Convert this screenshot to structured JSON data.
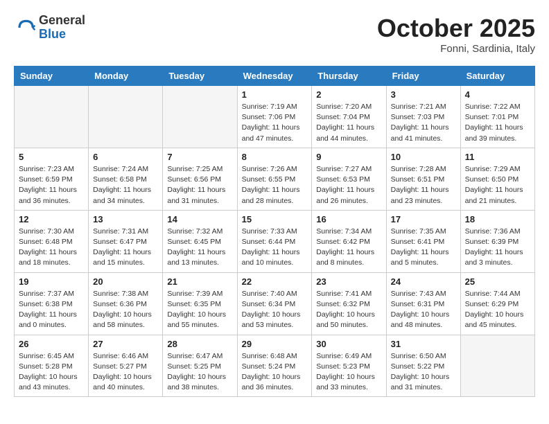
{
  "header": {
    "logo_general": "General",
    "logo_blue": "Blue",
    "month_title": "October 2025",
    "location": "Fonni, Sardinia, Italy"
  },
  "days_of_week": [
    "Sunday",
    "Monday",
    "Tuesday",
    "Wednesday",
    "Thursday",
    "Friday",
    "Saturday"
  ],
  "weeks": [
    [
      {
        "day": "",
        "info": ""
      },
      {
        "day": "",
        "info": ""
      },
      {
        "day": "",
        "info": ""
      },
      {
        "day": "1",
        "info": "Sunrise: 7:19 AM\nSunset: 7:06 PM\nDaylight: 11 hours\nand 47 minutes."
      },
      {
        "day": "2",
        "info": "Sunrise: 7:20 AM\nSunset: 7:04 PM\nDaylight: 11 hours\nand 44 minutes."
      },
      {
        "day": "3",
        "info": "Sunrise: 7:21 AM\nSunset: 7:03 PM\nDaylight: 11 hours\nand 41 minutes."
      },
      {
        "day": "4",
        "info": "Sunrise: 7:22 AM\nSunset: 7:01 PM\nDaylight: 11 hours\nand 39 minutes."
      }
    ],
    [
      {
        "day": "5",
        "info": "Sunrise: 7:23 AM\nSunset: 6:59 PM\nDaylight: 11 hours\nand 36 minutes."
      },
      {
        "day": "6",
        "info": "Sunrise: 7:24 AM\nSunset: 6:58 PM\nDaylight: 11 hours\nand 34 minutes."
      },
      {
        "day": "7",
        "info": "Sunrise: 7:25 AM\nSunset: 6:56 PM\nDaylight: 11 hours\nand 31 minutes."
      },
      {
        "day": "8",
        "info": "Sunrise: 7:26 AM\nSunset: 6:55 PM\nDaylight: 11 hours\nand 28 minutes."
      },
      {
        "day": "9",
        "info": "Sunrise: 7:27 AM\nSunset: 6:53 PM\nDaylight: 11 hours\nand 26 minutes."
      },
      {
        "day": "10",
        "info": "Sunrise: 7:28 AM\nSunset: 6:51 PM\nDaylight: 11 hours\nand 23 minutes."
      },
      {
        "day": "11",
        "info": "Sunrise: 7:29 AM\nSunset: 6:50 PM\nDaylight: 11 hours\nand 21 minutes."
      }
    ],
    [
      {
        "day": "12",
        "info": "Sunrise: 7:30 AM\nSunset: 6:48 PM\nDaylight: 11 hours\nand 18 minutes."
      },
      {
        "day": "13",
        "info": "Sunrise: 7:31 AM\nSunset: 6:47 PM\nDaylight: 11 hours\nand 15 minutes."
      },
      {
        "day": "14",
        "info": "Sunrise: 7:32 AM\nSunset: 6:45 PM\nDaylight: 11 hours\nand 13 minutes."
      },
      {
        "day": "15",
        "info": "Sunrise: 7:33 AM\nSunset: 6:44 PM\nDaylight: 11 hours\nand 10 minutes."
      },
      {
        "day": "16",
        "info": "Sunrise: 7:34 AM\nSunset: 6:42 PM\nDaylight: 11 hours\nand 8 minutes."
      },
      {
        "day": "17",
        "info": "Sunrise: 7:35 AM\nSunset: 6:41 PM\nDaylight: 11 hours\nand 5 minutes."
      },
      {
        "day": "18",
        "info": "Sunrise: 7:36 AM\nSunset: 6:39 PM\nDaylight: 11 hours\nand 3 minutes."
      }
    ],
    [
      {
        "day": "19",
        "info": "Sunrise: 7:37 AM\nSunset: 6:38 PM\nDaylight: 11 hours\nand 0 minutes."
      },
      {
        "day": "20",
        "info": "Sunrise: 7:38 AM\nSunset: 6:36 PM\nDaylight: 10 hours\nand 58 minutes."
      },
      {
        "day": "21",
        "info": "Sunrise: 7:39 AM\nSunset: 6:35 PM\nDaylight: 10 hours\nand 55 minutes."
      },
      {
        "day": "22",
        "info": "Sunrise: 7:40 AM\nSunset: 6:34 PM\nDaylight: 10 hours\nand 53 minutes."
      },
      {
        "day": "23",
        "info": "Sunrise: 7:41 AM\nSunset: 6:32 PM\nDaylight: 10 hours\nand 50 minutes."
      },
      {
        "day": "24",
        "info": "Sunrise: 7:43 AM\nSunset: 6:31 PM\nDaylight: 10 hours\nand 48 minutes."
      },
      {
        "day": "25",
        "info": "Sunrise: 7:44 AM\nSunset: 6:29 PM\nDaylight: 10 hours\nand 45 minutes."
      }
    ],
    [
      {
        "day": "26",
        "info": "Sunrise: 6:45 AM\nSunset: 5:28 PM\nDaylight: 10 hours\nand 43 minutes."
      },
      {
        "day": "27",
        "info": "Sunrise: 6:46 AM\nSunset: 5:27 PM\nDaylight: 10 hours\nand 40 minutes."
      },
      {
        "day": "28",
        "info": "Sunrise: 6:47 AM\nSunset: 5:25 PM\nDaylight: 10 hours\nand 38 minutes."
      },
      {
        "day": "29",
        "info": "Sunrise: 6:48 AM\nSunset: 5:24 PM\nDaylight: 10 hours\nand 36 minutes."
      },
      {
        "day": "30",
        "info": "Sunrise: 6:49 AM\nSunset: 5:23 PM\nDaylight: 10 hours\nand 33 minutes."
      },
      {
        "day": "31",
        "info": "Sunrise: 6:50 AM\nSunset: 5:22 PM\nDaylight: 10 hours\nand 31 minutes."
      },
      {
        "day": "",
        "info": ""
      }
    ]
  ]
}
